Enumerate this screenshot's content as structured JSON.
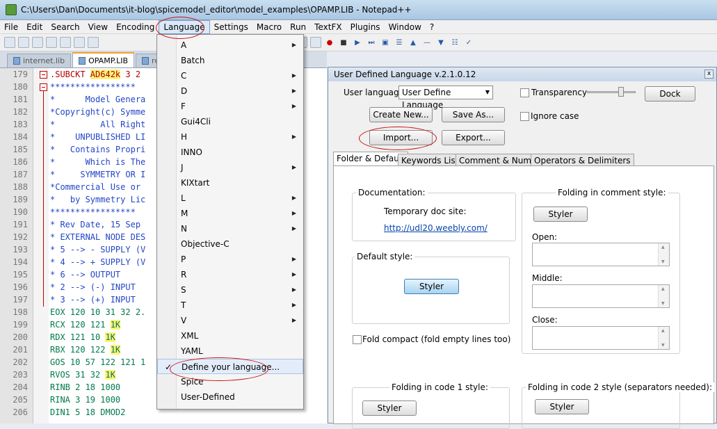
{
  "window": {
    "title": "C:\\Users\\Dan\\Documents\\it-blog\\spicemodel_editor\\model_examples\\OPAMP.LIB - Notepad++"
  },
  "menu": [
    "File",
    "Edit",
    "Search",
    "View",
    "Encoding",
    "Language",
    "Settings",
    "Macro",
    "Run",
    "TextFX",
    "Plugins",
    "Window",
    "?"
  ],
  "tabs": [
    "internet.lib",
    "OPAMP.LIB",
    "resistor"
  ],
  "editor_lines": [
    {
      "n": "179",
      "code": ".SUBCKT ",
      "hl": "AD642k",
      "rest": " 3 2",
      "cls": "red"
    },
    {
      "n": "180",
      "code": "*****************",
      "cls": "cmt"
    },
    {
      "n": "181",
      "code": "*      Model Genera",
      "cls": "cmt"
    },
    {
      "n": "182",
      "code": "*Copyright(c) Symme",
      "cls": "cmt"
    },
    {
      "n": "183",
      "code": "*         All Right",
      "cls": "cmt"
    },
    {
      "n": "184",
      "code": "*    UNPUBLISHED LI",
      "cls": "cmt"
    },
    {
      "n": "185",
      "code": "*   Contains Propri",
      "cls": "cmt"
    },
    {
      "n": "186",
      "code": "*      Which is The",
      "cls": "cmt"
    },
    {
      "n": "187",
      "code": "*     SYMMETRY OR I",
      "cls": "cmt"
    },
    {
      "n": "188",
      "code": "*Commercial Use or ",
      "cls": "cmt"
    },
    {
      "n": "189",
      "code": "*   by Symmetry Lic",
      "cls": "cmt"
    },
    {
      "n": "190",
      "code": "*****************",
      "cls": "cmt"
    },
    {
      "n": "191",
      "code": "* Rev Date, 15 Sep ",
      "cls": "cmt"
    },
    {
      "n": "192",
      "code": "* EXTERNAL NODE DES",
      "cls": "cmt"
    },
    {
      "n": "193",
      "code": "* 5 --> - SUPPLY (V",
      "cls": "cmt"
    },
    {
      "n": "194",
      "code": "* 4 --> + SUPPLY (V",
      "cls": "cmt"
    },
    {
      "n": "195",
      "code": "* 6 --> OUTPUT",
      "cls": "cmt"
    },
    {
      "n": "196",
      "code": "* 2 --> (-) INPUT",
      "cls": "cmt"
    },
    {
      "n": "197",
      "code": "* 3 --> (+) INPUT",
      "cls": "cmt"
    },
    {
      "n": "198",
      "code": "EOX 120 10 31 32 2.",
      "cls": "grn"
    },
    {
      "n": "199",
      "code": "RCX 120 121 ",
      "hl": "1K",
      "rest": "",
      "cls": "grn"
    },
    {
      "n": "200",
      "code": "RDX 121 10 ",
      "hl": "1K",
      "rest": "",
      "cls": "grn"
    },
    {
      "n": "201",
      "code": "RBX 120 122 ",
      "hl": "1K",
      "rest": "",
      "cls": "grn"
    },
    {
      "n": "202",
      "code": "GOS 10 57 122 121 1",
      "cls": "grn"
    },
    {
      "n": "203",
      "code": "RVOS 31 32 ",
      "hl": "1K",
      "rest": "",
      "cls": "grn"
    },
    {
      "n": "204",
      "code": "RINB 2 18 1000",
      "cls": "grn"
    },
    {
      "n": "205",
      "code": "RINA 3 19 1000",
      "cls": "grn"
    },
    {
      "n": "206",
      "code": "DIN1 5 18 DMOD2",
      "cls": "grn"
    }
  ],
  "language_menu": [
    {
      "label": "A",
      "sub": true
    },
    {
      "label": "Batch",
      "sub": false
    },
    {
      "label": "C",
      "sub": true
    },
    {
      "label": "D",
      "sub": true
    },
    {
      "label": "F",
      "sub": true
    },
    {
      "label": "Gui4Cli",
      "sub": false
    },
    {
      "label": "H",
      "sub": true
    },
    {
      "label": "INNO",
      "sub": false
    },
    {
      "label": "J",
      "sub": true
    },
    {
      "label": "KIXtart",
      "sub": false
    },
    {
      "label": "L",
      "sub": true
    },
    {
      "label": "M",
      "sub": true
    },
    {
      "label": "N",
      "sub": true
    },
    {
      "label": "Objective-C",
      "sub": false
    },
    {
      "label": "P",
      "sub": true
    },
    {
      "label": "R",
      "sub": true
    },
    {
      "label": "S",
      "sub": true
    },
    {
      "label": "T",
      "sub": true
    },
    {
      "label": "V",
      "sub": true
    },
    {
      "label": "XML",
      "sub": false
    },
    {
      "label": "YAML",
      "sub": false
    },
    {
      "label": "Define your language...",
      "sub": false,
      "checked": true
    },
    {
      "label": "Spice",
      "sub": false
    },
    {
      "label": "User-Defined",
      "sub": false
    }
  ],
  "udl": {
    "title": "User Defined Language v.2.1.0.12",
    "close": "x",
    "user_language_label": "User language :",
    "user_language_value": "User Define Language",
    "transparency": "Transparency",
    "dock": "Dock",
    "create_new": "Create New...",
    "save_as": "Save As...",
    "ignore_case": "Ignore case",
    "import": "Import...",
    "export": "Export...",
    "tabs": [
      "Folder & Default",
      "Keywords Lists",
      "Comment & Number",
      "Operators & Delimiters"
    ],
    "documentation": "Documentation:",
    "temp_doc": "Temporary doc site:",
    "doc_link": "http://udl20.weebly.com/",
    "default_style": "Default style:",
    "styler": "Styler",
    "fold_compact": "Fold compact (fold empty lines too)",
    "folding_comment": "Folding in comment style:",
    "open": "Open:",
    "middle": "Middle:",
    "close_label": "Close:",
    "folding_code1": "Folding in code 1 style:",
    "folding_code2": "Folding in code 2 style (separators needed):"
  }
}
